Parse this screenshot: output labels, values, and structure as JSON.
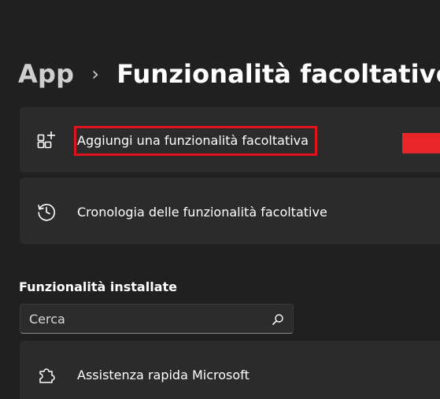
{
  "breadcrumb": {
    "parent": "App",
    "separator": "›",
    "current": "Funzionalità facoltative"
  },
  "cards": {
    "add": {
      "label": "Aggiungi una funzionalità facoltativa",
      "icon": "add-apps-icon"
    },
    "history": {
      "label": "Cronologia delle funzionalità facoltative",
      "icon": "history-icon"
    }
  },
  "installed": {
    "title": "Funzionalità installate",
    "search": {
      "placeholder": "Cerca",
      "icon": "search-icon"
    },
    "items": [
      {
        "label": "Assistenza rapida Microsoft",
        "icon": "puzzle-icon"
      }
    ]
  },
  "colors": {
    "background": "#202020",
    "card": "#2b2b2b",
    "highlight": "#e0121b",
    "button_fill": "#e8262a"
  }
}
